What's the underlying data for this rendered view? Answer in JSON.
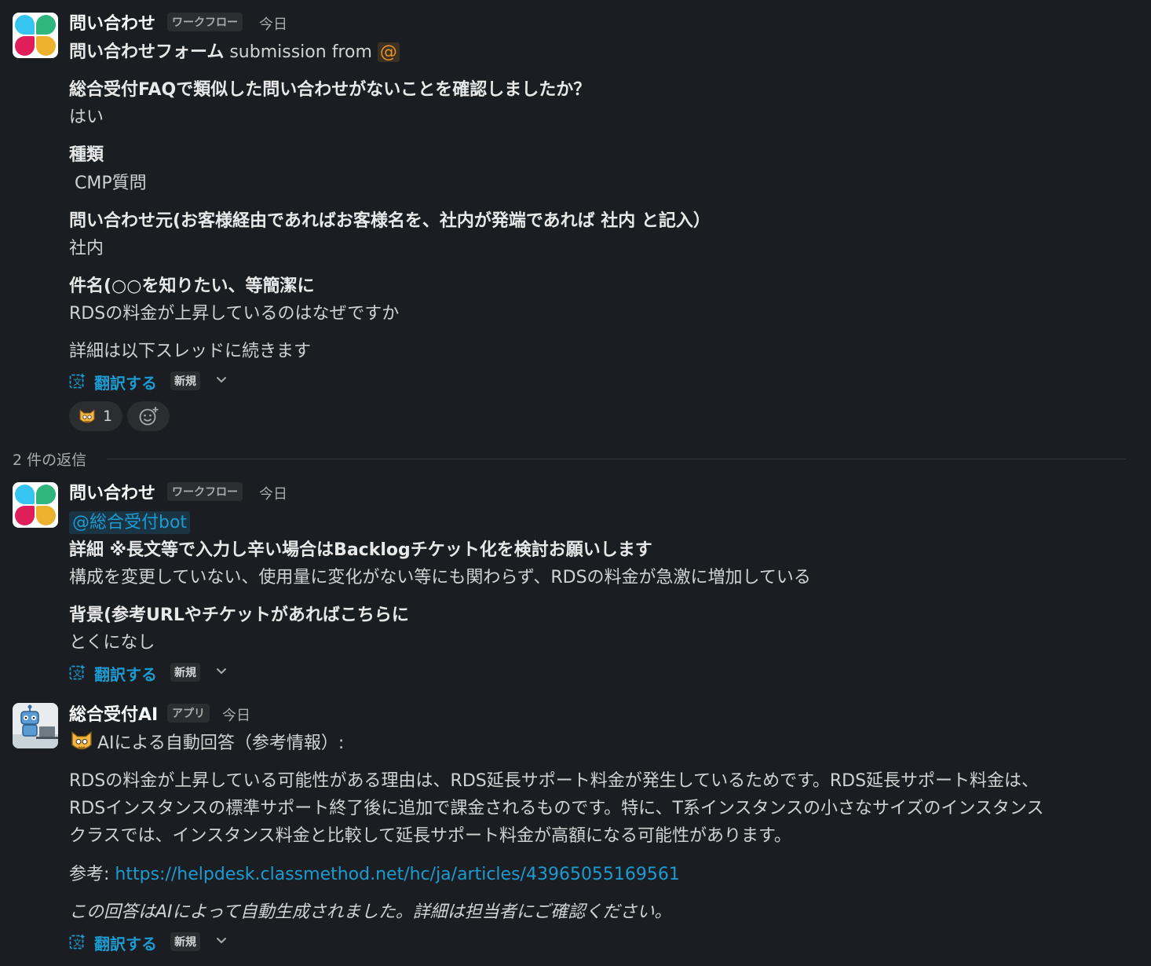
{
  "msg1": {
    "sender": "問い合わせ",
    "badge": "ワークフロー",
    "time": "今日",
    "form_title": "問い合わせフォーム",
    "submission_text": "submission from",
    "mention": "@",
    "fields": [
      {
        "label": "総合受付FAQで類似した問い合わせがないことを確認しましたか？",
        "value": "はい"
      },
      {
        "label": "種類",
        "value": " CMP質問"
      },
      {
        "label": "問い合わせ元(お客様経由であればお客様名を、社内が発端であれば 社内 と記入）",
        "value": "社内"
      },
      {
        "label": "件名(○○を知りたい、等簡潔に",
        "value": "RDSの料金が上昇しているのはなぜですか"
      }
    ],
    "footer": "詳細は以下スレッドに続きます",
    "translate_label": "翻訳する",
    "new_badge": "新規",
    "reaction_count": "1"
  },
  "thread": {
    "replies_label": "2 件の返信"
  },
  "msg2": {
    "sender": "問い合わせ",
    "badge": "ワークフロー",
    "time": "今日",
    "mention": "@総合受付bot",
    "fields": [
      {
        "label": "詳細 ※長文等で入力し辛い場合はBacklogチケット化を検討お願いします",
        "value": "構成を変更していない、使用量に変化がない等にも関わらず、RDSの料金が急激に増加している"
      },
      {
        "label": "背景(参考URLやチケットがあればこちらに",
        "value": "とくになし"
      }
    ],
    "translate_label": "翻訳する",
    "new_badge": "新規"
  },
  "msg3": {
    "sender": "総合受付AI",
    "badge": "アプリ",
    "time": "今日",
    "intro": "AIによる自動回答（参考情報）:",
    "body_lines": [
      "RDSの料金が上昇している可能性がある理由は、RDS延長サポート料金が発生しているためです。RDS延長サポート料金は、",
      "RDSインスタンスの標準サポート終了後に追加で課金されるものです。特に、T系インスタンスの小さなサイズのインスタンス",
      "クラスでは、インスタンス料金と比較して延長サポート料金が高額になる可能性があります。"
    ],
    "ref_label": "参考:",
    "ref_url": "https://helpdesk.classmethod.net/hc/ja/articles/43965055169561",
    "disclaimer": "この回答はAIによって自動生成されました。詳細は担当者にご確認ください。",
    "translate_label": "翻訳する",
    "new_badge": "新規"
  },
  "colors": {
    "background": "#1a1d21",
    "text": "#d1d2d3",
    "link": "#1d9bd1",
    "mention_yellow": "#e8912d"
  }
}
